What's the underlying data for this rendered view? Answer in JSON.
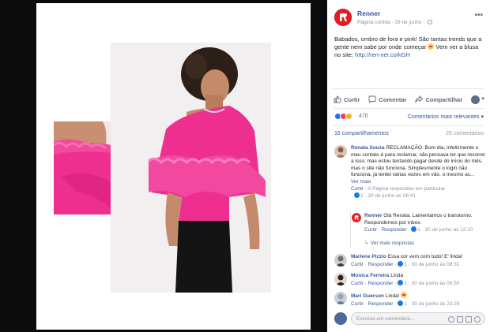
{
  "post": {
    "page_name": "Renner",
    "meta_liked": "Página curtida",
    "meta_date": "29 de junho",
    "meta_sep": "·",
    "text": "Babados, ombro de fora e pink! São tantas trends que a gente nem sabe por onde começar",
    "text_after": "Vem ver a blusa no site:",
    "link": "http://ren-ner.co/kGH"
  },
  "actions": {
    "like": "Curtir",
    "comment": "Comentar",
    "share": "Compartilhar"
  },
  "reactions": {
    "count": "470",
    "order": "Comentários mais relevantes",
    "order_caret": "▾",
    "shares": "16 compartilhamentos",
    "comments": "25 comentários"
  },
  "comments": [
    {
      "name": "Renata Souza",
      "text": "RECLAMAÇÃO: Bom dia, infelizmente o meu contato é para reclamar, não pensava ter que recorrer a isso, mas estou tentando pagar desde do início do mês, mas o site não funciona. Simplesmente o login não funciona, já tentei várias vezes em vão, o mesmo ac...",
      "more": "Ver mais",
      "foot_like": "Curtir",
      "foot_reply": "Responder",
      "foot_extra": "A Página respondeu em particular",
      "foot_count": "1",
      "foot_time": "30 de junho às 08:41"
    },
    {
      "name": "Renner",
      "text": "Olá Renata. Lamentamos o transtorno. Respondemos por inbox.",
      "foot_like": "Curtir",
      "foot_reply": "Responder",
      "foot_count": "1",
      "foot_time": "30 de junho às 12:10"
    },
    {
      "name": "Marlene Pizzio",
      "text": "Essa cor vem com tudo! E' linda!",
      "foot_like": "Curtir",
      "foot_reply": "Responder",
      "foot_count": "1",
      "foot_time": "30 de junho às 08:31"
    },
    {
      "name": "Monica Ferreira",
      "text": "Linda",
      "foot_like": "Curtir",
      "foot_reply": "Responder",
      "foot_count": "1",
      "foot_time": "30 de junho às 00:50"
    },
    {
      "name": "Mari Guerson",
      "text": "Linda!",
      "foot_like": "Curtir",
      "foot_reply": "Responder",
      "foot_count": "1",
      "foot_time": "30 de junho às 23:28"
    }
  ],
  "view_more_replies": "Ver mais respostas",
  "write_comment": {
    "placeholder": "Escreva um comentário..."
  },
  "colors": {
    "brand": "#e31b23",
    "link": "#365899",
    "pink_blouse": "#ee2f8f",
    "facebook_blue": "#1877f2"
  }
}
